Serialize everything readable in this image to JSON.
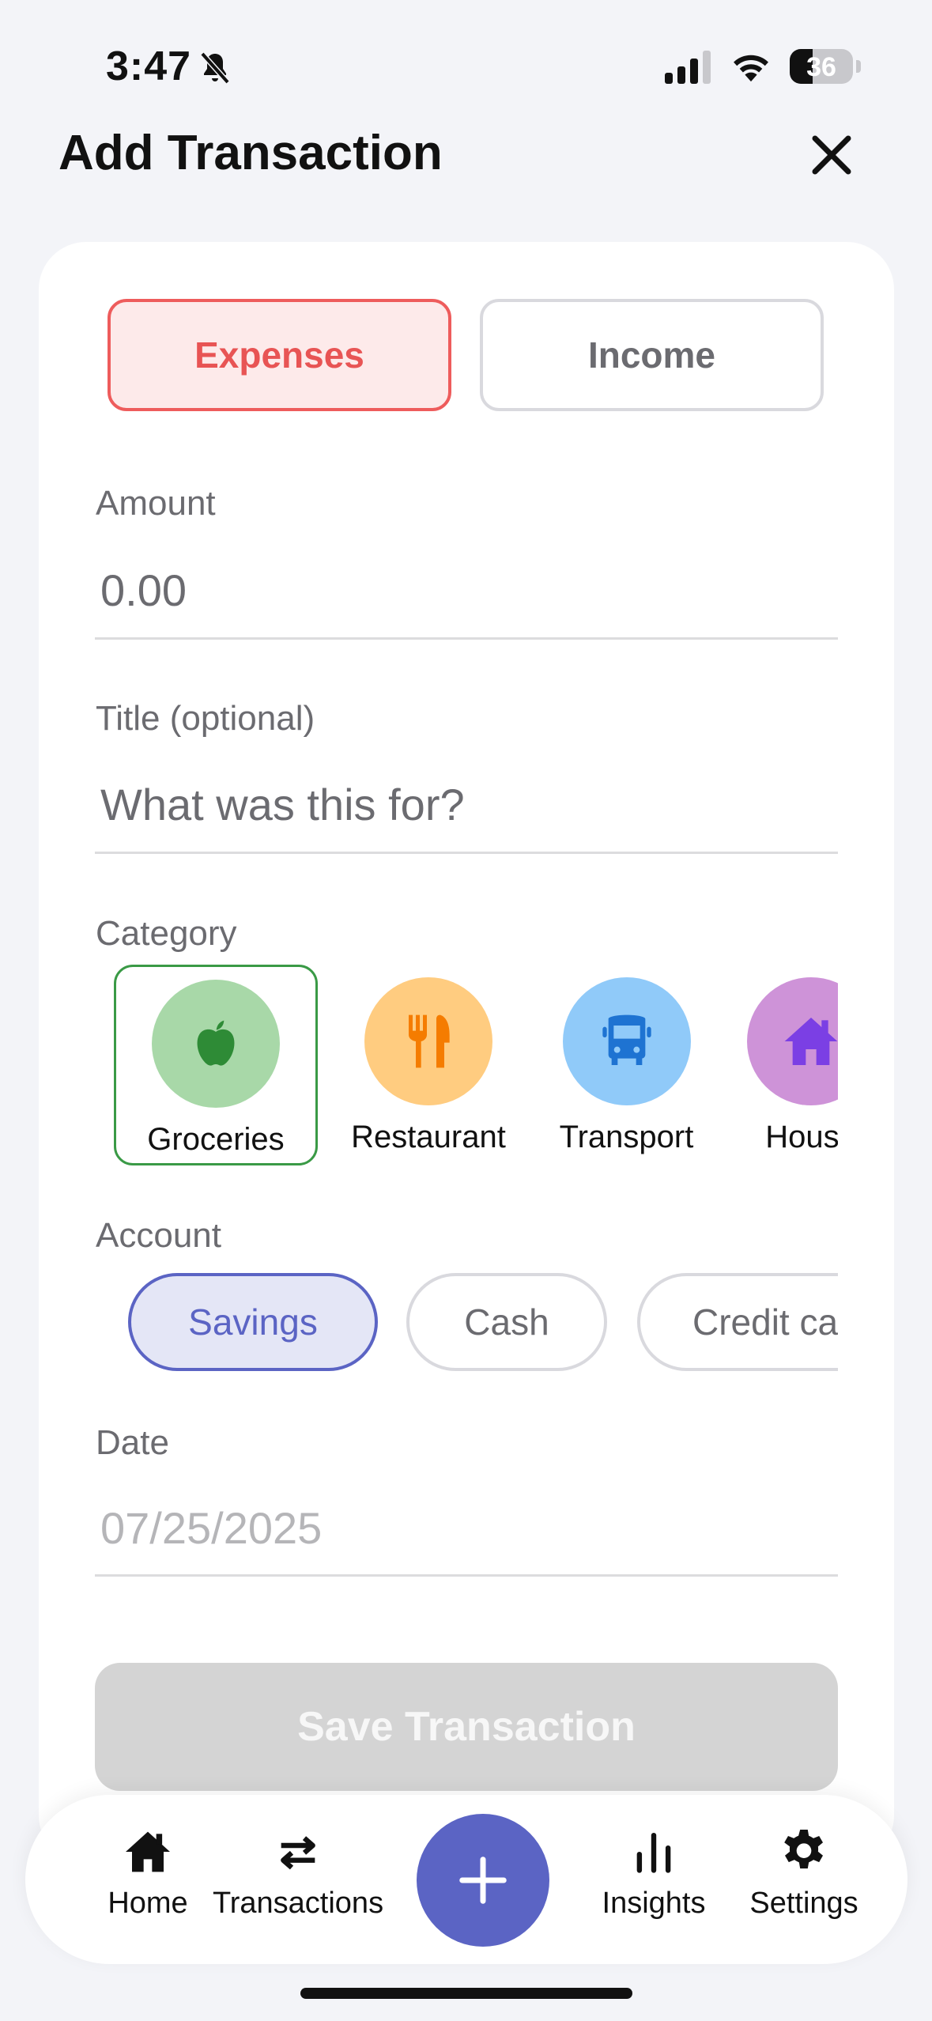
{
  "status_bar": {
    "time": "3:47",
    "battery": "36",
    "battery_level": 0.36
  },
  "header": {
    "title": "Add Transaction"
  },
  "type_toggle": {
    "expenses": "Expenses",
    "income": "Income",
    "selected": "Expenses"
  },
  "amount": {
    "label": "Amount",
    "placeholder": "0.00"
  },
  "title_field": {
    "label": "Title (optional)",
    "placeholder": "What was this for?"
  },
  "category": {
    "label": "Category",
    "items": [
      {
        "label": "Groceries",
        "icon": "apple-icon",
        "color": "#a8d8a8",
        "icon_color": "#2e8b36",
        "selected": true
      },
      {
        "label": "Restaurant",
        "icon": "fork-knife-icon",
        "color": "#ffcc80",
        "icon_color": "#f57c00",
        "selected": false
      },
      {
        "label": "Transport",
        "icon": "bus-icon",
        "color": "#90caf9",
        "icon_color": "#1e73d2",
        "selected": false
      },
      {
        "label": "House",
        "icon": "house-icon",
        "color": "#ce93d8",
        "icon_color": "#7b3fe4",
        "selected": false
      }
    ]
  },
  "account": {
    "label": "Account",
    "items": [
      {
        "label": "Savings",
        "selected": true
      },
      {
        "label": "Cash",
        "selected": false
      },
      {
        "label": "Credit card",
        "selected": false
      }
    ]
  },
  "date": {
    "label": "Date",
    "value": "07/25/2025"
  },
  "save_label": "Save Transaction",
  "nav": {
    "home": "Home",
    "transactions": "Transactions",
    "insights": "Insights",
    "settings": "Settings"
  },
  "colors": {
    "accent": "#5b64c4",
    "expense": "#e85454",
    "success": "#3a9a46"
  }
}
